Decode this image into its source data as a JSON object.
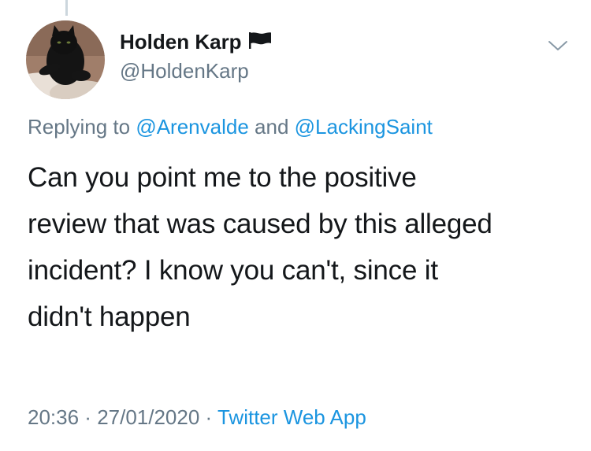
{
  "author": {
    "display_name": "Holden Karp",
    "handle": "@HoldenKarp",
    "avatar_icon": "black-cat-avatar",
    "badge_icon": "black-flag-icon"
  },
  "reply": {
    "prefix": "Replying to ",
    "mention_1": "@Arenvalde",
    "connector": " and ",
    "mention_2": "@LackingSaint"
  },
  "tweet": {
    "text": "Can you point me to the positive\nreview that was caused by this alleged\nincident? I know you can't, since it\ndidn't happen"
  },
  "meta": {
    "time": "20:36",
    "separator_1": " · ",
    "date": "27/01/2020",
    "separator_2": " · ",
    "source": "Twitter Web App"
  },
  "colors": {
    "link": "#1b95e0",
    "secondary_text": "#657786",
    "primary_text": "#14171a",
    "thread_line": "#ccd6dd"
  },
  "menu": {
    "icon": "chevron-down-icon"
  }
}
